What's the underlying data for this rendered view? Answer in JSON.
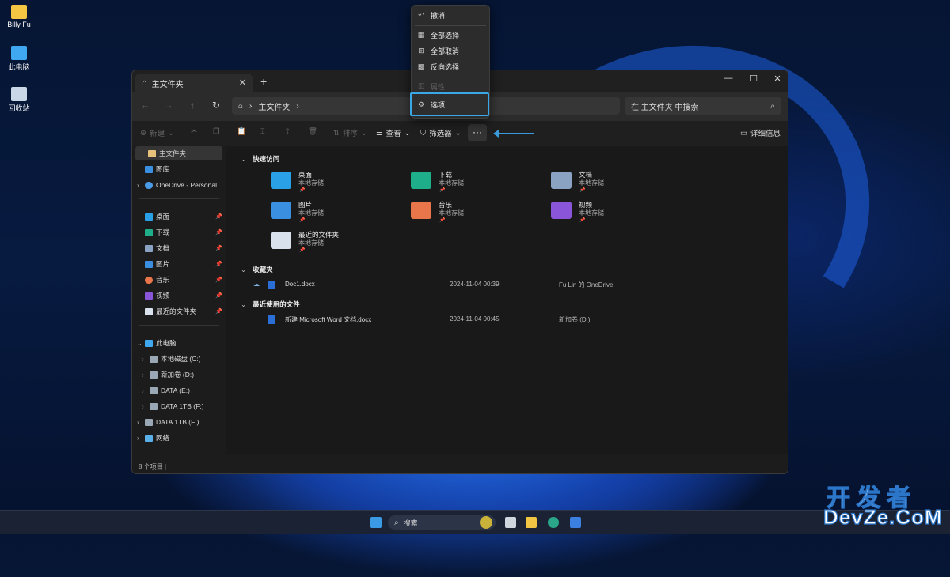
{
  "desktop": {
    "icons": [
      {
        "label": "Billy Fu",
        "icon": "folder-icon"
      },
      {
        "label": "此电脑",
        "icon": "computer-icon"
      },
      {
        "label": "回收站",
        "icon": "recycle-bin-icon"
      }
    ]
  },
  "explorer": {
    "tab_title": "主文件夹",
    "address": "主文件夹",
    "search_placeholder": "在 主文件夹 中搜索",
    "toolbar": {
      "new_label": "新建",
      "sort_label": "排序",
      "view_label": "查看",
      "filter_label": "筛选器",
      "more_label": "···",
      "details_label": "详细信息"
    },
    "sidebar": {
      "top": [
        {
          "label": "主文件夹",
          "selected": true
        },
        {
          "label": "图库"
        },
        {
          "label": "OneDrive - Personal"
        }
      ],
      "pinned": [
        {
          "label": "桌面"
        },
        {
          "label": "下载"
        },
        {
          "label": "文档"
        },
        {
          "label": "图片"
        },
        {
          "label": "音乐"
        },
        {
          "label": "视频"
        },
        {
          "label": "最近的文件夹"
        }
      ],
      "pc": [
        {
          "label": "此电脑"
        },
        {
          "label": "本地磁盘 (C:)"
        },
        {
          "label": "新加卷 (D:)"
        },
        {
          "label": "DATA (E:)"
        },
        {
          "label": "DATA 1TB (F:)"
        },
        {
          "label": "DATA 1TB (F:)"
        },
        {
          "label": "网络"
        }
      ]
    },
    "quick_access_title": "快速访问",
    "quick_access": [
      {
        "name": "桌面",
        "sub": "本地存储",
        "color": "#2aa0e6"
      },
      {
        "name": "下载",
        "sub": "本地存储",
        "color": "#1fae8a"
      },
      {
        "name": "文档",
        "sub": "本地存储",
        "color": "#8aa3c2"
      },
      {
        "name": "图片",
        "sub": "本地存储",
        "color": "#3a8fe0"
      },
      {
        "name": "音乐",
        "sub": "本地存储",
        "color": "#e8764a"
      },
      {
        "name": "视频",
        "sub": "本地存储",
        "color": "#8a55d8"
      },
      {
        "name": "最近的文件夹",
        "sub": "本地存储",
        "color": "#d9e2ec"
      }
    ],
    "favorites_title": "收藏夹",
    "favorites": [
      {
        "name": "Doc1.docx",
        "date": "2024-11-04 00:39",
        "location": "Fu Lin 的 OneDrive"
      }
    ],
    "recent_title": "最近使用的文件",
    "recent": [
      {
        "name": "新建 Microsoft Word 文档.docx",
        "date": "2024-11-04 00:45",
        "location": "新加卷 (D:)"
      }
    ],
    "status": "8 个项目  |"
  },
  "context_menu": {
    "items": [
      {
        "label": "撤消",
        "icon": "undo-icon",
        "enabled": true
      },
      {
        "label": "全部选择",
        "icon": "select-all-icon",
        "enabled": true
      },
      {
        "label": "全部取消",
        "icon": "select-none-icon",
        "enabled": true
      },
      {
        "label": "反向选择",
        "icon": "invert-selection-icon",
        "enabled": true
      },
      {
        "label": "属性",
        "icon": "properties-icon",
        "enabled": false
      },
      {
        "label": "选项",
        "icon": "gear-icon",
        "enabled": true,
        "highlighted": true
      }
    ]
  },
  "taskbar": {
    "search_label": "搜索"
  },
  "watermark": {
    "cn": "开发者",
    "en": "DevZe.CoM"
  }
}
